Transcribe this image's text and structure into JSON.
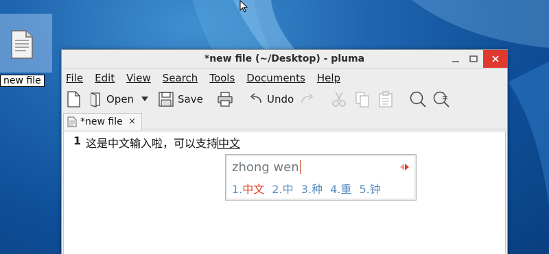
{
  "desktop": {
    "icon_label": "new file",
    "icon": "text-file-icon",
    "cursor": "mouse-pointer-icon"
  },
  "window": {
    "title": "*new file (~/Desktop) - pluma",
    "controls": {
      "minimize": "minimize-icon",
      "maximize": "maximize-icon",
      "close": "close-icon"
    }
  },
  "menubar": {
    "file": "File",
    "edit": "Edit",
    "view": "View",
    "search": "Search",
    "tools": "Tools",
    "documents": "Documents",
    "help": "Help"
  },
  "toolbar": {
    "new_icon": "new-document-icon",
    "open_label": "Open",
    "save_label": "Save",
    "print_icon": "print-icon",
    "undo_label": "Undo",
    "redo_icon": "redo-icon",
    "cut_icon": "cut-icon",
    "copy_icon": "copy-icon",
    "paste_icon": "paste-icon",
    "find_icon": "find-icon",
    "replace_icon": "find-replace-icon"
  },
  "tab": {
    "label": "*new file",
    "close": "×"
  },
  "editor": {
    "line_number": "1",
    "text_committed": "这是中文输入啦，可以支持",
    "text_preedit": "中文"
  },
  "ime": {
    "input": "zhong wen",
    "candidates": [
      {
        "index": "1.",
        "text": "中文"
      },
      {
        "index": "2.",
        "text": "中"
      },
      {
        "index": "3.",
        "text": "种"
      },
      {
        "index": "4.",
        "text": "重"
      },
      {
        "index": "5.",
        "text": "钟"
      }
    ],
    "colors": {
      "selected": "#e04020",
      "candidate": "#5a8ec0"
    }
  }
}
